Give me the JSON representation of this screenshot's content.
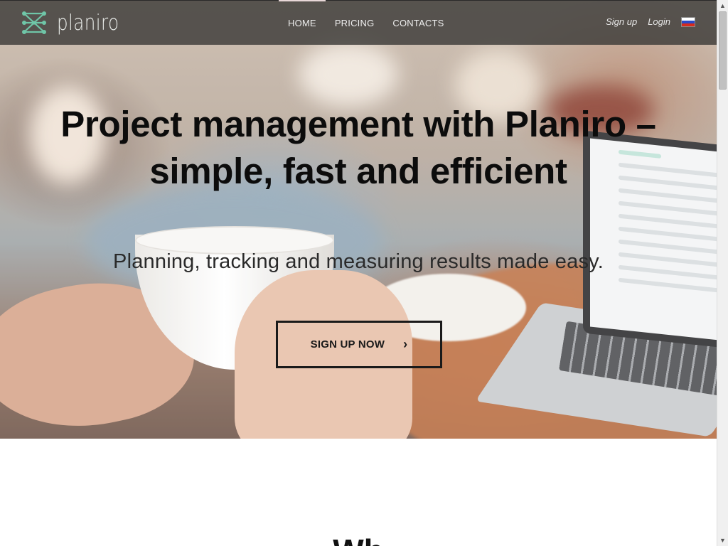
{
  "brand": {
    "name": "planiro",
    "accent": "#6fc6a8"
  },
  "nav": {
    "links": [
      {
        "label": "HOME",
        "active": true
      },
      {
        "label": "PRICING",
        "active": false
      },
      {
        "label": "CONTACTS",
        "active": false
      }
    ],
    "signup_label": "Sign up",
    "login_label": "Login",
    "language_flag": "ru-flag-icon"
  },
  "hero": {
    "title_line1": "Project management with Planiro –",
    "title_line2": "simple, fast and efficient",
    "subtitle": "Planning, tracking and measuring results made easy.",
    "cta_label": "SIGN UP NOW",
    "cta_icon": "chevron-right-icon"
  },
  "section": {
    "heading_partial": "Wh"
  },
  "colors": {
    "navbar_bg": "#3c3a38",
    "text_dark": "#0c0c0c"
  }
}
